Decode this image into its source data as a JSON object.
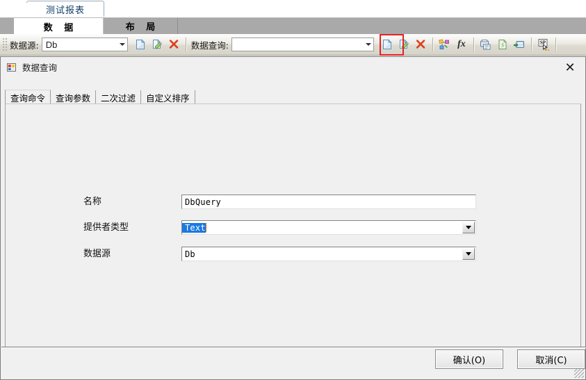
{
  "app": {
    "document_tab": "测试报表",
    "ribbon_tabs": [
      {
        "label": "数 据",
        "active": true
      },
      {
        "label": "布 局",
        "active": false
      }
    ]
  },
  "toolbar": {
    "datasource_label": "数据源:",
    "datasource_value": "Db",
    "query_label": "数据查询:",
    "query_value": "",
    "buttons": [
      {
        "name": "new-datasource-icon",
        "title": "新建"
      },
      {
        "name": "edit-datasource-icon",
        "title": "编辑"
      },
      {
        "name": "delete-datasource-icon",
        "title": "删除"
      },
      {
        "name": "new-query-icon",
        "title": "新建查询",
        "highlighted": true
      },
      {
        "name": "edit-query-icon",
        "title": "编辑查询"
      },
      {
        "name": "delete-query-icon",
        "title": "删除查询"
      },
      {
        "name": "relation-icon",
        "title": "关系"
      },
      {
        "name": "function-fx-icon",
        "title": "函数"
      },
      {
        "name": "print-dataset-icon",
        "title": "打印"
      },
      {
        "name": "script-doc-icon",
        "title": "脚本"
      },
      {
        "name": "import-icon",
        "title": "导入"
      },
      {
        "name": "sp-cursor-icon",
        "title": "存储过程"
      }
    ]
  },
  "dialog": {
    "title": "数据查询",
    "icon": "form-icon",
    "close_label": "✕",
    "tabs": [
      {
        "label": "查询命令",
        "active": true
      },
      {
        "label": "查询参数",
        "active": false
      },
      {
        "label": "二次过滤",
        "active": false
      },
      {
        "label": "自定义排序",
        "active": false
      }
    ],
    "fields": [
      {
        "name": "name",
        "label": "名称",
        "value": "DbQuery",
        "type": "text",
        "selected": false
      },
      {
        "name": "provider-type",
        "label": "提供者类型",
        "value": "Text",
        "type": "combobox",
        "selected": true
      },
      {
        "name": "datasource",
        "label": "数据源",
        "value": "Db",
        "type": "combobox",
        "selected": false
      }
    ],
    "ok_label": "确认(O)",
    "cancel_label": "取消(C)"
  },
  "colors": {
    "highlight_box": "#e4221f",
    "selection_blue": "#1a7ae0",
    "dialog_bg": "#f0f0f0",
    "ribbon_bg": "#a9a9a9"
  }
}
